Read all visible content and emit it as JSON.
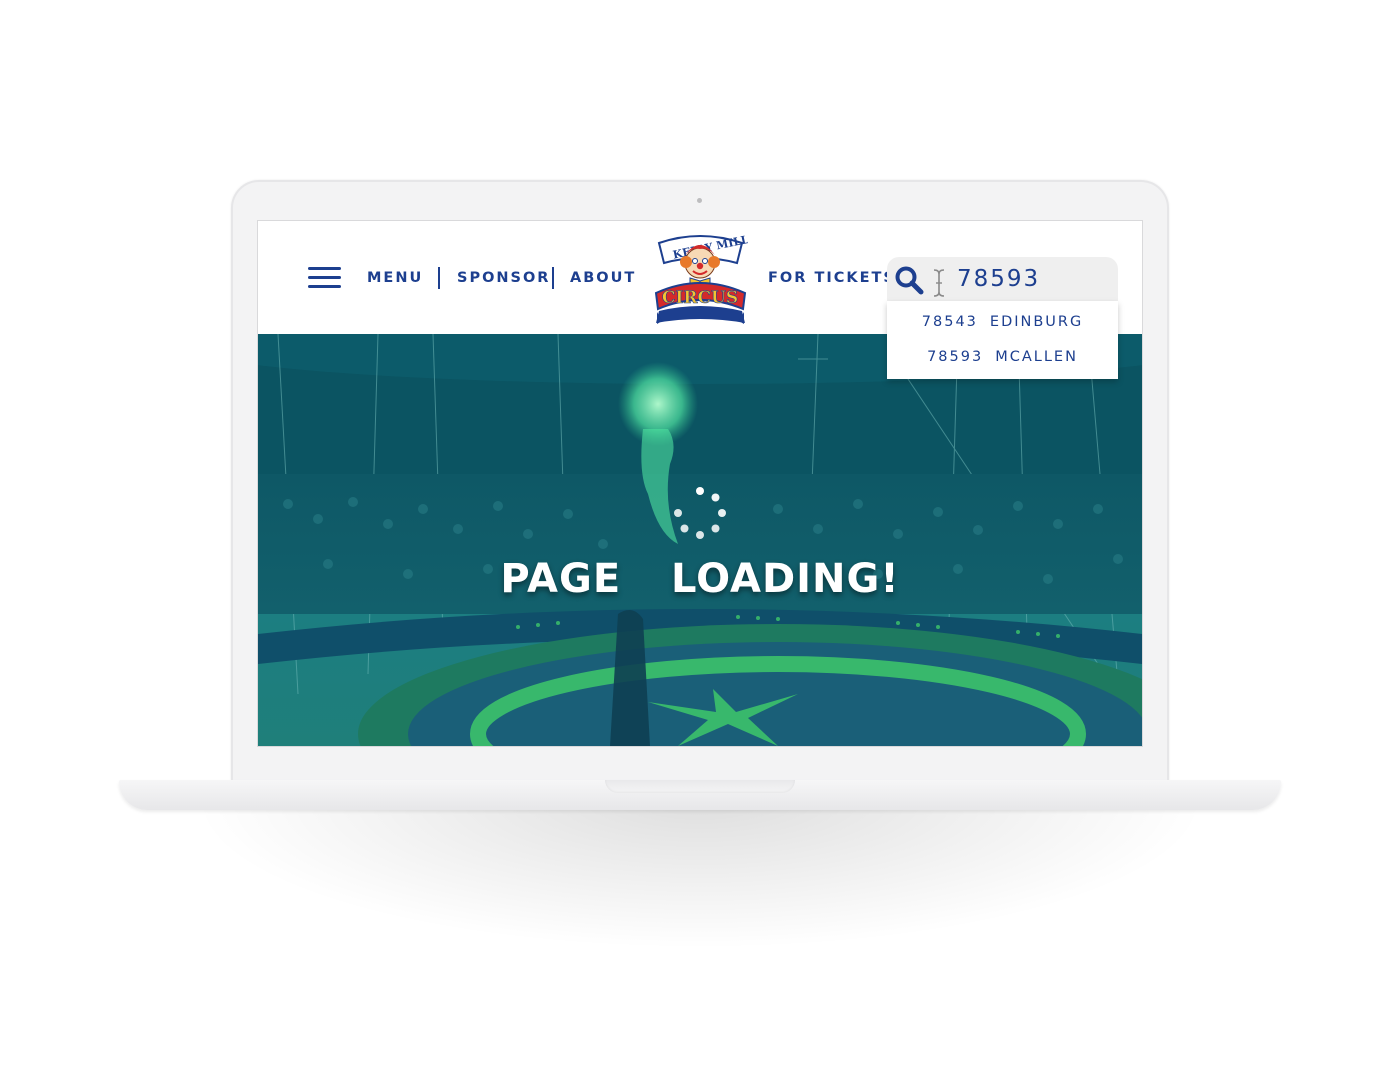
{
  "header": {
    "menu_label": "MENU",
    "sponsor_label": "SPONSOR",
    "about_label": "ABOUT",
    "tickets_label": "FOR TICKETS",
    "logo": {
      "top_text": "KELLY MILLER",
      "bottom_text": "CIRCUS"
    }
  },
  "search": {
    "value": "78593",
    "suggestions": [
      {
        "zip": "78543",
        "city": "EDINBURG"
      },
      {
        "zip": "78593",
        "city": "MCALLEN"
      }
    ]
  },
  "hero": {
    "loading_text": "PAGE  LOADING!"
  },
  "colors": {
    "brand_blue": "#1d3f8f",
    "logo_red": "#d42a2a",
    "hero_teal": "#157684",
    "ring_green": "#3ec86a"
  },
  "icons": [
    "hamburger-icon",
    "search-icon",
    "text-cursor-icon",
    "loading-spinner-icon",
    "clown-logo"
  ]
}
